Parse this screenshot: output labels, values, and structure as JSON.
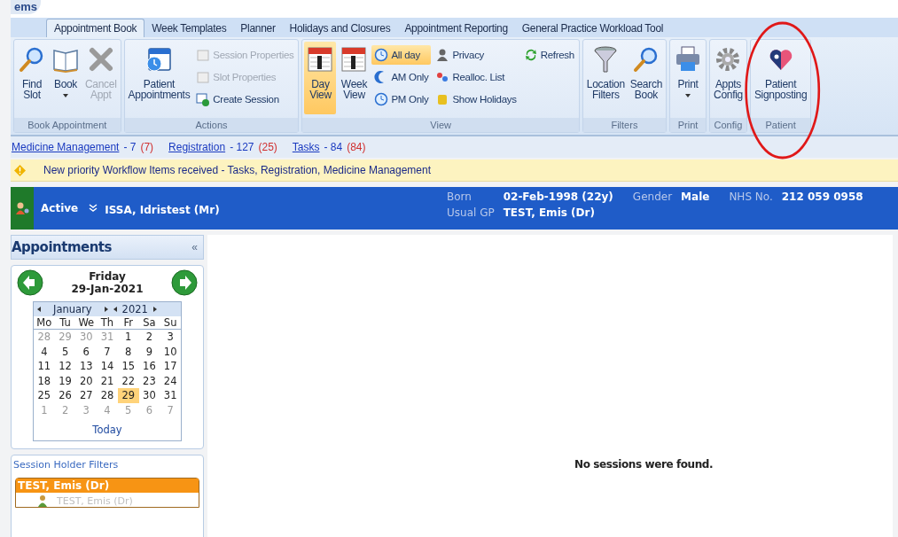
{
  "logo": "ems",
  "tabs": [
    {
      "label": "Appointment Book",
      "selected": true
    },
    {
      "label": "Week Templates",
      "selected": false
    },
    {
      "label": "Planner",
      "selected": false
    },
    {
      "label": "Holidays and Closures",
      "selected": false
    },
    {
      "label": "Appointment Reporting",
      "selected": false
    },
    {
      "label": "General Practice Workload Tool",
      "selected": false
    }
  ],
  "ribbon_groups": [
    {
      "title": "Book Appointment",
      "circled": false,
      "items": [
        {
          "kind": "large",
          "label": "Find Slot",
          "disabled": false,
          "selected": false,
          "dropdown": false
        },
        {
          "kind": "large",
          "label": "Book",
          "disabled": false,
          "selected": false,
          "dropdown": true
        },
        {
          "kind": "large",
          "label": "Cancel Appt",
          "disabled": true,
          "selected": false,
          "dropdown": false
        }
      ]
    },
    {
      "title": "Actions",
      "circled": false,
      "items": [
        {
          "kind": "large",
          "label": "Patient Appointments",
          "disabled": false,
          "selected": false,
          "dropdown": false
        },
        {
          "kind": "stack",
          "items": [
            {
              "label": "Session Properties",
              "disabled": true,
              "selected": false
            },
            {
              "label": "Slot Properties",
              "disabled": true,
              "selected": false
            },
            {
              "label": "Create Session",
              "disabled": false,
              "selected": false
            }
          ]
        }
      ]
    },
    {
      "title": "View",
      "circled": false,
      "items": [
        {
          "kind": "large",
          "label": "Day View",
          "disabled": false,
          "selected": true,
          "dropdown": false
        },
        {
          "kind": "large",
          "label": "Week View",
          "disabled": false,
          "selected": false,
          "dropdown": false
        },
        {
          "kind": "stack",
          "items": [
            {
              "label": "All day",
              "disabled": false,
              "selected": true
            },
            {
              "label": "AM Only",
              "disabled": false,
              "selected": false
            },
            {
              "label": "PM Only",
              "disabled": false,
              "selected": false
            }
          ]
        },
        {
          "kind": "stack",
          "items": [
            {
              "label": "Privacy",
              "disabled": false,
              "selected": false
            },
            {
              "label": "Realloc. List",
              "disabled": false,
              "selected": false
            },
            {
              "label": "Show Holidays",
              "disabled": false,
              "selected": false
            }
          ]
        },
        {
          "kind": "stack",
          "items": [
            {
              "label": "Refresh",
              "disabled": false,
              "selected": false
            }
          ]
        }
      ]
    },
    {
      "title": "Filters",
      "circled": false,
      "items": [
        {
          "kind": "large",
          "label": "Location Filters",
          "disabled": false,
          "selected": false,
          "dropdown": false
        },
        {
          "kind": "large",
          "label": "Search Book",
          "disabled": false,
          "selected": false,
          "dropdown": false
        }
      ]
    },
    {
      "title": "Print",
      "circled": false,
      "items": [
        {
          "kind": "large",
          "label": "Print",
          "disabled": false,
          "selected": false,
          "dropdown": true
        }
      ]
    },
    {
      "title": "Config",
      "circled": false,
      "items": [
        {
          "kind": "large",
          "label": "Appts Config",
          "disabled": false,
          "selected": false,
          "dropdown": false
        }
      ]
    },
    {
      "title": "Patient",
      "circled": true,
      "items": [
        {
          "kind": "large",
          "label": "Patient Signposting",
          "disabled": false,
          "selected": false,
          "dropdown": false
        }
      ]
    }
  ],
  "workflow": [
    {
      "link": "Medicine Management",
      "count": "- 7",
      "new": "(7)"
    },
    {
      "link": "Registration",
      "count": "- 127",
      "new": "(25)"
    },
    {
      "link": "Tasks",
      "count": "- 84",
      "new": "(84)"
    }
  ],
  "banner": "New priority Workflow Items received - Tasks, Registration, Medicine Management",
  "patient": {
    "status": "Active",
    "name": "ISSA, Idristest (Mr)",
    "fields": [
      {
        "label": "Born",
        "value": "02-Feb-1998 (22y)"
      },
      {
        "label": "Gender",
        "value": "Male"
      },
      {
        "label": "NHS No.",
        "value": "212 059 0958"
      },
      {
        "label": "Usual GP",
        "value": "TEST, Emis (Dr)"
      }
    ]
  },
  "sidebar": {
    "title": "Appointments",
    "collapse": "«",
    "day": "Friday",
    "date": "29-Jan-2021",
    "calendar": {
      "month": "January",
      "year": "2021",
      "weekdays": [
        "Mo",
        "Tu",
        "We",
        "Th",
        "Fr",
        "Sa",
        "Su"
      ],
      "weeks": [
        [
          {
            "d": "28",
            "other": true,
            "selected": false
          },
          {
            "d": "29",
            "other": true,
            "selected": false
          },
          {
            "d": "30",
            "other": true,
            "selected": false
          },
          {
            "d": "31",
            "other": true,
            "selected": false
          },
          {
            "d": "1",
            "other": false,
            "selected": false
          },
          {
            "d": "2",
            "other": false,
            "selected": false
          },
          {
            "d": "3",
            "other": false,
            "selected": false
          }
        ],
        [
          {
            "d": "4",
            "other": false,
            "selected": false
          },
          {
            "d": "5",
            "other": false,
            "selected": false
          },
          {
            "d": "6",
            "other": false,
            "selected": false
          },
          {
            "d": "7",
            "other": false,
            "selected": false
          },
          {
            "d": "8",
            "other": false,
            "selected": false
          },
          {
            "d": "9",
            "other": false,
            "selected": false
          },
          {
            "d": "10",
            "other": false,
            "selected": false
          }
        ],
        [
          {
            "d": "11",
            "other": false,
            "selected": false
          },
          {
            "d": "12",
            "other": false,
            "selected": false
          },
          {
            "d": "13",
            "other": false,
            "selected": false
          },
          {
            "d": "14",
            "other": false,
            "selected": false
          },
          {
            "d": "15",
            "other": false,
            "selected": false
          },
          {
            "d": "16",
            "other": false,
            "selected": false
          },
          {
            "d": "17",
            "other": false,
            "selected": false
          }
        ],
        [
          {
            "d": "18",
            "other": false,
            "selected": false
          },
          {
            "d": "19",
            "other": false,
            "selected": false
          },
          {
            "d": "20",
            "other": false,
            "selected": false
          },
          {
            "d": "21",
            "other": false,
            "selected": false
          },
          {
            "d": "22",
            "other": false,
            "selected": false
          },
          {
            "d": "23",
            "other": false,
            "selected": false
          },
          {
            "d": "24",
            "other": false,
            "selected": false
          }
        ],
        [
          {
            "d": "25",
            "other": false,
            "selected": false
          },
          {
            "d": "26",
            "other": false,
            "selected": false
          },
          {
            "d": "27",
            "other": false,
            "selected": false
          },
          {
            "d": "28",
            "other": false,
            "selected": false
          },
          {
            "d": "29",
            "other": false,
            "selected": true
          },
          {
            "d": "30",
            "other": false,
            "selected": false
          },
          {
            "d": "31",
            "other": false,
            "selected": false
          }
        ],
        [
          {
            "d": "1",
            "other": true,
            "selected": false
          },
          {
            "d": "2",
            "other": true,
            "selected": false
          },
          {
            "d": "3",
            "other": true,
            "selected": false
          },
          {
            "d": "4",
            "other": true,
            "selected": false
          },
          {
            "d": "5",
            "other": true,
            "selected": false
          },
          {
            "d": "6",
            "other": true,
            "selected": false
          },
          {
            "d": "7",
            "other": true,
            "selected": false
          }
        ]
      ],
      "today": "Today"
    },
    "filters_title": "Session Holder Filters",
    "holder_group": "TEST, Emis (Dr)",
    "holder": "TEST, Emis (Dr)"
  },
  "main_message": "No sessions were found."
}
